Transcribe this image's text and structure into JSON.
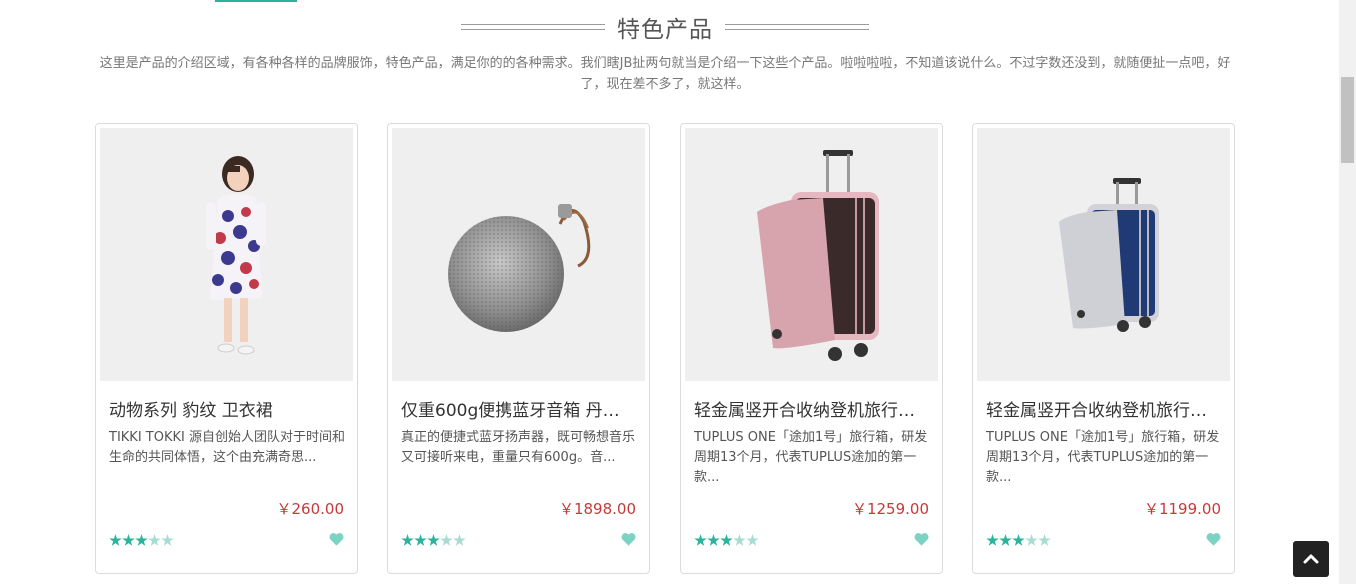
{
  "section": {
    "title": "特色产品",
    "intro": "这里是产品的介绍区域，有各种各样的品牌服饰，特色产品，满足你的的各种需求。我们瞎JB扯两句就当是介绍一下这些个产品。啦啦啦啦，不知道该说什么。不过字数还没到，就随便扯一点吧，好了，现在差不多了，就这样。"
  },
  "colors": {
    "accent": "#2bb39b",
    "price": "#c43a3a"
  },
  "products": [
    {
      "name": "动物系列 豹纹 卫衣裙",
      "desc": "TIKKI TOKKI 源自创始人团队对于时间和生命的共同体悟，这个由充满奇思...",
      "price": "￥260.00",
      "rating": 3,
      "rating_max": 5,
      "image": "girl-in-leopard-dress"
    },
    {
      "name": "仅重600g便携蓝牙音箱 丹…",
      "desc": "真正的便捷式蓝牙扬声器，既可畅想音乐又可接听来电，重量只有600g。音...",
      "price": "￥1898.00",
      "rating": 3,
      "rating_max": 5,
      "image": "round-bluetooth-speaker"
    },
    {
      "name": "轻金属竖开合收纳登机旅行…",
      "desc": "TUPLUS ONE「途加1号」旅行箱，研发周期13个月，代表TUPLUS途加的第一款...",
      "price": "￥1259.00",
      "rating": 3,
      "rating_max": 5,
      "image": "pink-suitcase"
    },
    {
      "name": "轻金属竖开合收纳登机旅行…",
      "desc": "TUPLUS ONE「途加1号」旅行箱，研发周期13个月，代表TUPLUS途加的第一款...",
      "price": "￥1199.00",
      "rating": 3,
      "rating_max": 5,
      "image": "silver-suitcase"
    }
  ],
  "icons": {
    "favorite": "heart-icon",
    "back_to_top": "chevron-up-icon",
    "rating": "star-icon"
  }
}
